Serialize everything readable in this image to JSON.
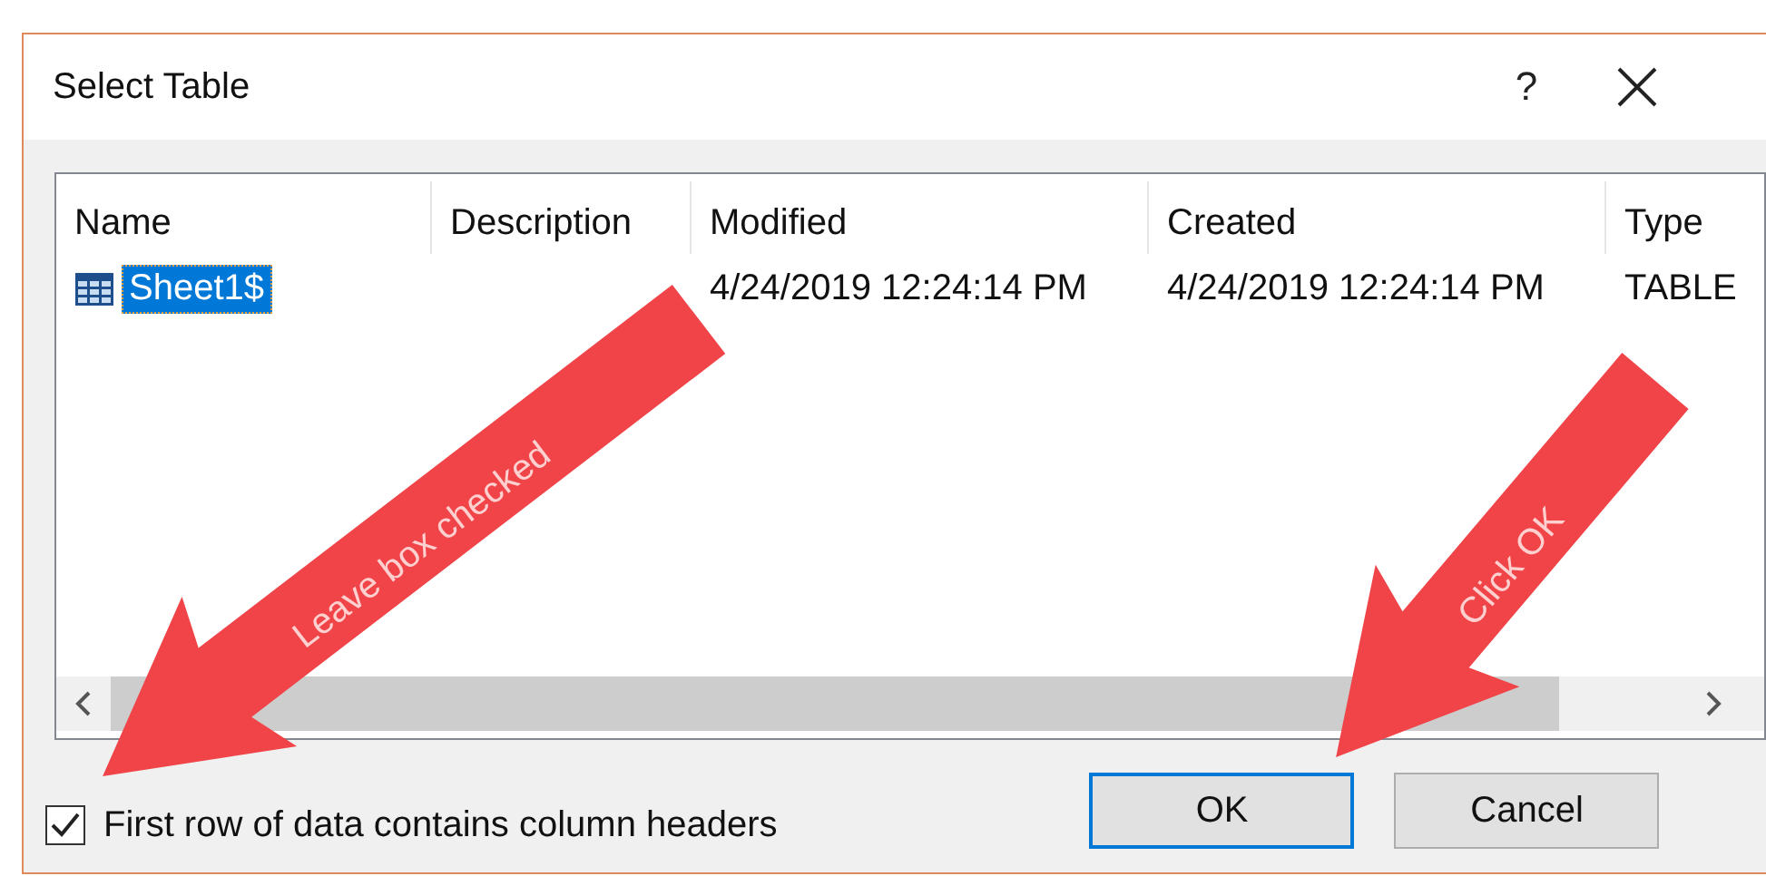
{
  "window": {
    "title": "Select Table",
    "help": "?"
  },
  "table": {
    "columns": [
      "Name",
      "Description",
      "Modified",
      "Created",
      "Type"
    ],
    "rows": [
      {
        "cells": [
          "Sheet1$",
          "",
          "4/24/2019 12:24:14 PM",
          "4/24/2019 12:24:14 PM",
          "TABLE"
        ],
        "selected": true
      }
    ]
  },
  "checkbox": {
    "label": "First row of data contains column headers",
    "checked": true
  },
  "buttons": [
    {
      "label": "OK",
      "default": true
    },
    {
      "label": "Cancel",
      "default": false
    }
  ],
  "annotations": [
    {
      "text": "Leave box checked"
    },
    {
      "text": "Click OK"
    }
  ]
}
